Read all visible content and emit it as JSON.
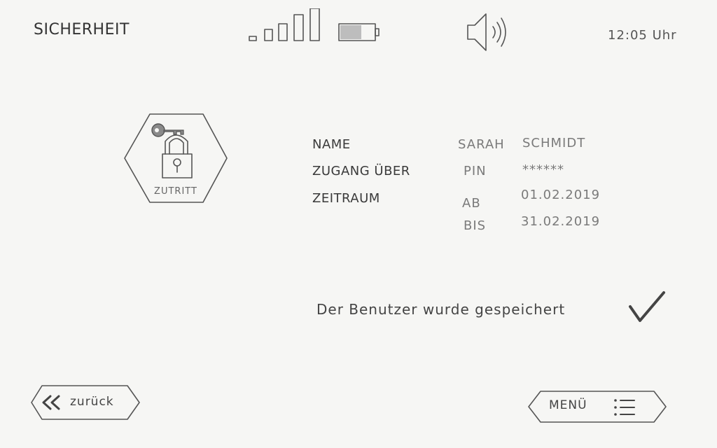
{
  "header": {
    "title": "SICHERHEIT",
    "time": "12:05 Uhr",
    "status_icons": [
      "signal-strength-icon",
      "battery-icon",
      "speaker-volume-icon"
    ]
  },
  "access_badge": {
    "icon": "key-padlock-icon",
    "label": "ZUTRITT"
  },
  "user_info": {
    "name_label": "NAME",
    "name_first": "SARAH",
    "name_last": "SCHMIDT",
    "access_label": "ZUGANG ÜBER",
    "access_method": "PIN",
    "access_value": "******",
    "period_label": "ZEITRAUM",
    "from_label": "AB",
    "from_date": "01.02.2019",
    "to_label": "BIS",
    "to_date": "31.02.2019"
  },
  "confirmation": {
    "message": "Der Benutzer wurde gespeichert",
    "icon": "checkmark-icon"
  },
  "footer": {
    "back_label": "zurück",
    "back_icon": "double-chevron-left-icon",
    "menu_label": "MENÜ",
    "menu_icon": "menu-list-icon"
  }
}
